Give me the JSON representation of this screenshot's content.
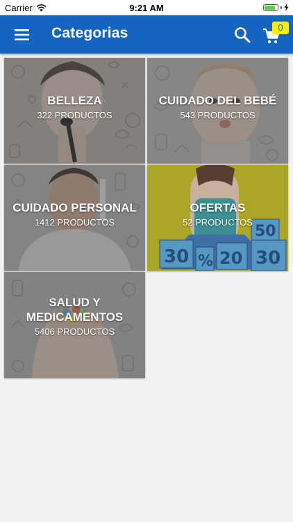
{
  "status_bar": {
    "carrier": "Carrier",
    "time": "9:21 AM",
    "battery_level": 0.85
  },
  "app_bar": {
    "title": "Categorias",
    "menu_icon": "hamburger-menu-icon",
    "search_icon": "search-icon",
    "cart_icon": "shopping-cart-icon",
    "cart_count": "0",
    "color": "#1565c0",
    "badge_color": "#ffee00"
  },
  "categories": [
    {
      "name": "BELLEZA",
      "count": "322 PRODUCTOS"
    },
    {
      "name": "CUIDADO DEL BEBÉ",
      "count": "543 PRODUCTOS"
    },
    {
      "name": "CUIDADO PERSONAL",
      "count": "1412 PRODUCTOS"
    },
    {
      "name": "OFERTAS",
      "count": "52 PRODUCTOS"
    },
    {
      "name": "SALUD Y MEDICAMENTOS",
      "count": "5406 PRODUCTOS"
    }
  ]
}
